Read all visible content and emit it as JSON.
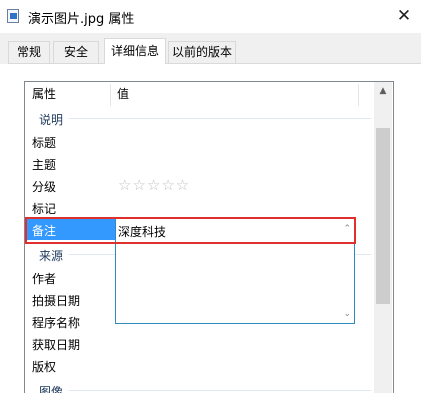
{
  "window": {
    "title": "演示图片.jpg 属性",
    "close_glyph": "✕"
  },
  "tabs": [
    {
      "label": "常规"
    },
    {
      "label": "安全"
    },
    {
      "label": "详细信息"
    },
    {
      "label": "以前的版本"
    }
  ],
  "active_tab": "详细信息",
  "list": {
    "columns": {
      "property": "属性",
      "value": "值"
    },
    "groups": {
      "description": "说明",
      "source": "来源",
      "image": "图像"
    },
    "rows": {
      "title": "标题",
      "subject": "主题",
      "rating": "分级",
      "tags": "标记",
      "comments": "备注",
      "authors": "作者",
      "date_taken": "拍摄日期",
      "program_name": "程序名称",
      "date_acquired": "获取日期",
      "copyright": "版权"
    },
    "rating_stars": "☆☆☆☆☆",
    "rating_value": 0,
    "comments_value": "深度科技"
  },
  "scroll_glyphs": {
    "up": "▲",
    "small_up": "⌃",
    "small_down": "⌄"
  },
  "colors": {
    "selection": "#3399ff",
    "group_text": "#1e395b",
    "highlight_border": "#e0302d",
    "editor_border": "#2e8bbd"
  }
}
